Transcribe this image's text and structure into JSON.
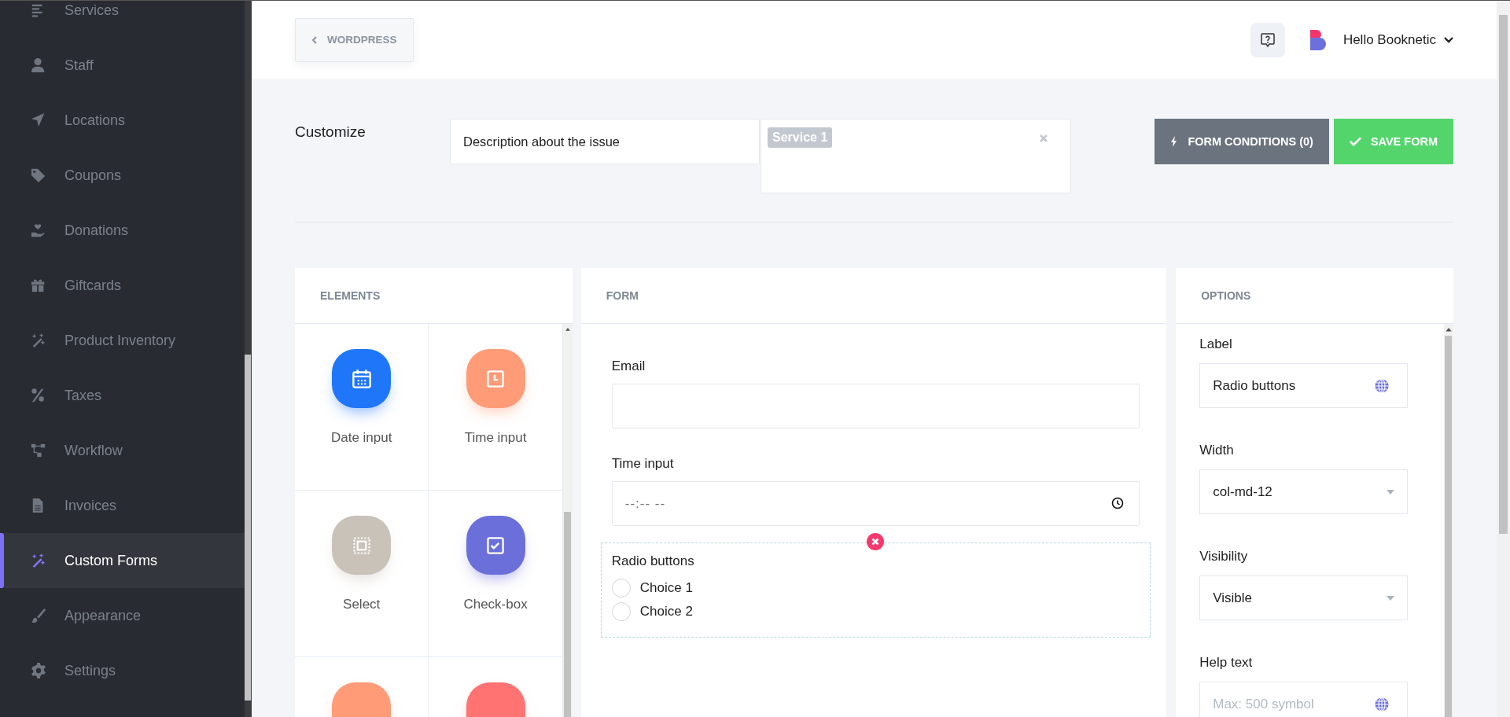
{
  "sidebar": {
    "items": [
      {
        "label": "Services",
        "selected": false
      },
      {
        "label": "Staff",
        "selected": false
      },
      {
        "label": "Locations",
        "selected": false
      },
      {
        "label": "Coupons",
        "selected": false
      },
      {
        "label": "Donations",
        "selected": false
      },
      {
        "label": "Giftcards",
        "selected": false
      },
      {
        "label": "Product Inventory",
        "selected": false
      },
      {
        "label": "Taxes",
        "selected": false
      },
      {
        "label": "Workflow",
        "selected": false
      },
      {
        "label": "Invoices",
        "selected": false
      },
      {
        "label": "Custom Forms",
        "selected": true
      },
      {
        "label": "Appearance",
        "selected": false
      },
      {
        "label": "Settings",
        "selected": false
      }
    ]
  },
  "header": {
    "back_button": "WORDPRESS",
    "user_menu": "Hello Booknetic"
  },
  "customize": {
    "title": "Customize",
    "name_field": {
      "value": "Description about the issue"
    },
    "services": {
      "tags": [
        "Service 1"
      ]
    },
    "conditions_button": "FORM CONDITIONS (0)",
    "save_button": "SAVE FORM"
  },
  "elements": {
    "title": "ELEMENTS",
    "items": [
      {
        "kind": "date",
        "label": "Date input",
        "color": "#1f76f9"
      },
      {
        "kind": "time",
        "label": "Time input",
        "color": "#ff9b77"
      },
      {
        "kind": "select",
        "label": "Select",
        "color": "#c8c2b8"
      },
      {
        "kind": "checkbox",
        "label": "Check-box",
        "color": "#6b6fda"
      },
      {
        "kind": "radio",
        "color": "#ff9b77"
      },
      {
        "kind": "textarea",
        "color": "#ff7373"
      }
    ]
  },
  "form": {
    "title": "FORM",
    "fields": [
      {
        "kind": "email",
        "label": "Email",
        "selected": false
      },
      {
        "kind": "time",
        "label": "Time input",
        "placeholder": "--:-- --",
        "selected": false
      },
      {
        "kind": "radio",
        "label": "Radio buttons",
        "selected": true,
        "choices": [
          {
            "label": "Choice 1",
            "checked": false
          },
          {
            "label": "Choice 2",
            "checked": false
          }
        ]
      }
    ]
  },
  "options": {
    "title": "OPTIONS",
    "fields": [
      {
        "kind": "text",
        "label": "Label",
        "value": "Radio buttons"
      },
      {
        "kind": "select",
        "label": "Width",
        "value": "col-md-12"
      },
      {
        "kind": "select",
        "label": "Visibility",
        "value": "Visible"
      },
      {
        "kind": "text",
        "label": "Help text",
        "placeholder": "Max: 500 symbol"
      }
    ]
  }
}
